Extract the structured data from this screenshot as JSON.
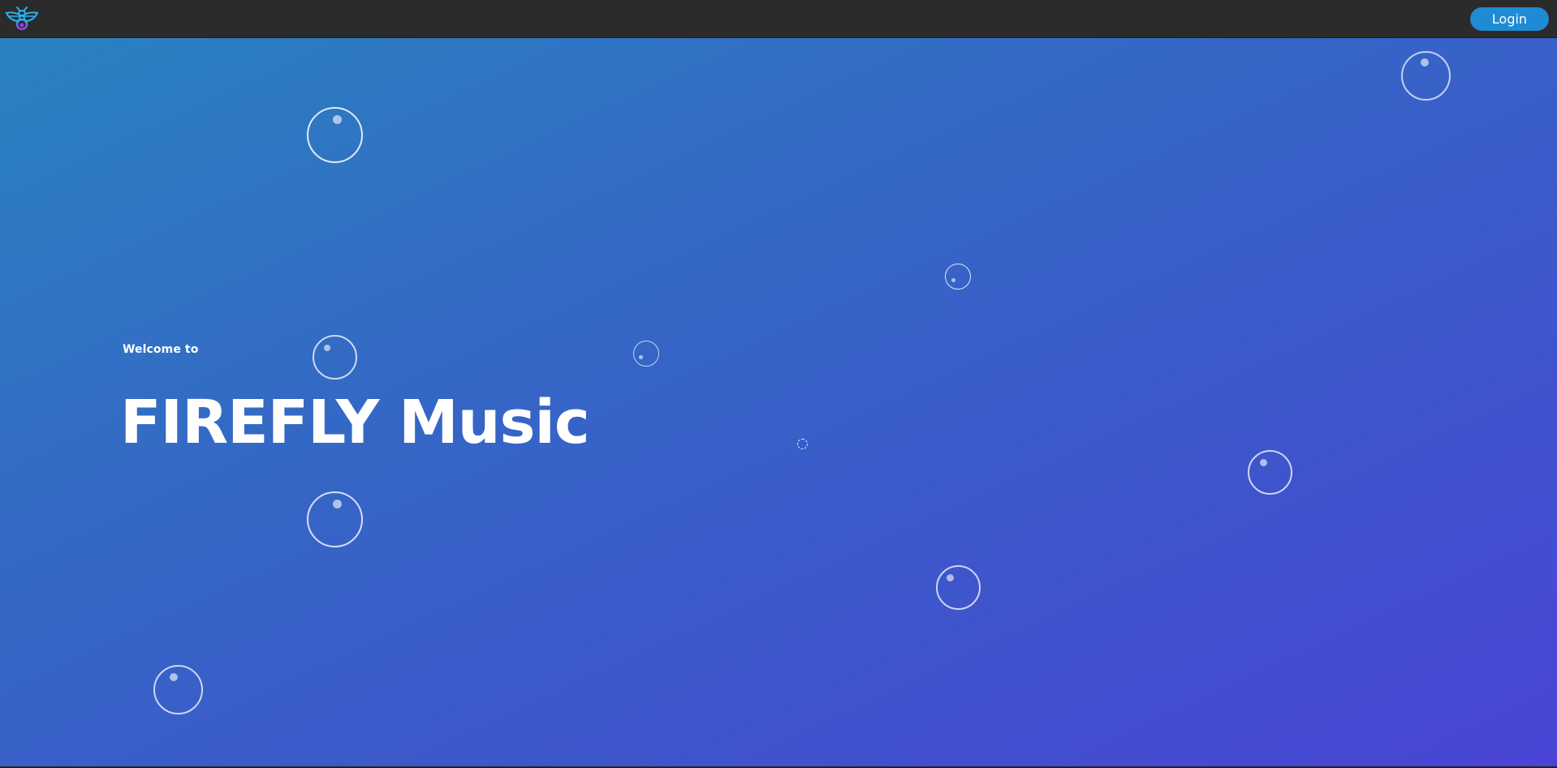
{
  "header": {
    "logo_icon": "firefly-logo-icon",
    "login_label": "Login"
  },
  "hero": {
    "welcome_text": "Welcome to",
    "title": "FIREFLY Music"
  },
  "colors": {
    "topbar": "#2b2b2b",
    "login_button": "#1f8bd4",
    "gradient_start": "#2a82c0",
    "gradient_end": "#4a44d6",
    "text": "#ffffff"
  },
  "decorations": {
    "bubble_icon": "bubble-icon"
  }
}
